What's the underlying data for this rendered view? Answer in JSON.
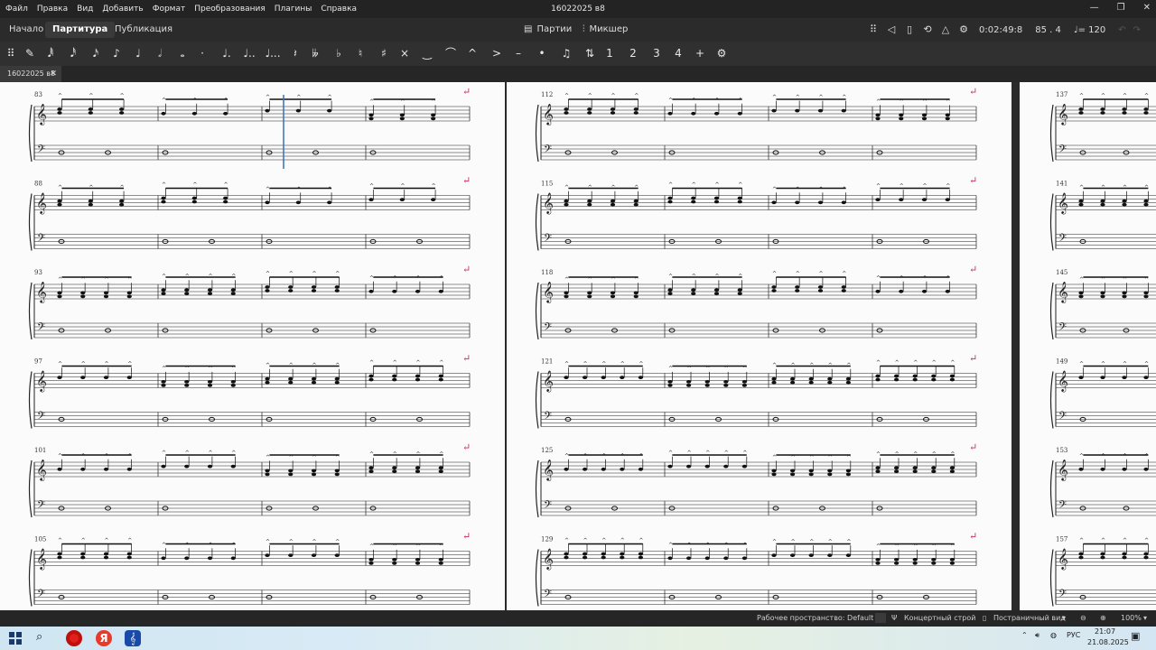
{
  "app": {
    "window_title": "16022025 в8",
    "menu": [
      "Файл",
      "Правка",
      "Вид",
      "Добавить",
      "Формат",
      "Преобразования",
      "Плагины",
      "Справка"
    ]
  },
  "tabs": {
    "main": [
      "Начало",
      "Партитура",
      "Публикация"
    ],
    "active": "Партитура",
    "parts_label": "Партии",
    "mixer_label": "Микшер"
  },
  "playback": {
    "time": "0:02:49:8",
    "position": "85 . 4",
    "tempo": "= 120"
  },
  "note_toolbar": {
    "items": [
      "input-mode",
      "pen",
      "sixty-fourth",
      "thirty-second",
      "sixteenth",
      "eighth",
      "quarter",
      "half",
      "whole",
      "dot",
      "double-dot",
      "triple-dot",
      "quadruple-dot",
      "rest",
      "double-flat",
      "flat",
      "natural",
      "sharp",
      "double-sharp",
      "tie",
      "slur",
      "marcato",
      "accent",
      "tenuto",
      "staccato",
      "tuplet",
      "flip",
      "voice-1",
      "voice-2",
      "voice-3",
      "voice-4",
      "add",
      "customize"
    ]
  },
  "document_tab": {
    "name": "16022025 в8"
  },
  "score": {
    "page1_measures": [
      "83",
      "88",
      "93",
      "97",
      "101",
      "105"
    ],
    "page2_measures": [
      "112",
      "115",
      "118",
      "121",
      "125",
      "129"
    ],
    "page3_measures": [
      "137",
      "141",
      "145",
      "149",
      "153",
      "157"
    ]
  },
  "status": {
    "workspace": "Рабочее пространство: Default",
    "concert_pitch": "Концертный строй",
    "view_mode": "Постраничный вид",
    "zoom": "100%"
  },
  "taskbar": {
    "language": "РУС",
    "time": "21:07",
    "date": "21.08.2025"
  }
}
